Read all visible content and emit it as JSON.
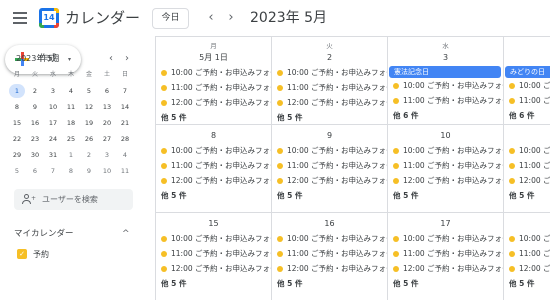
{
  "header": {
    "logo_text": "14",
    "app_title": "カレンダー",
    "today_label": "今日",
    "prev_icon": "‹",
    "next_icon": "›",
    "month_title": "2023年 5月"
  },
  "sidebar": {
    "create_label": "作成",
    "create_caret": "▾",
    "mini_calendar": {
      "title": "2023年 5月",
      "prev_icon": "‹",
      "next_icon": "›",
      "weekdays": [
        "月",
        "火",
        "水",
        "木",
        "金",
        "土",
        "日"
      ],
      "weeks": [
        [
          "1",
          "2",
          "3",
          "4",
          "5",
          "6",
          "7"
        ],
        [
          "8",
          "9",
          "10",
          "11",
          "12",
          "13",
          "14"
        ],
        [
          "15",
          "16",
          "17",
          "18",
          "19",
          "20",
          "21"
        ],
        [
          "22",
          "23",
          "24",
          "25",
          "26",
          "27",
          "28"
        ],
        [
          "29",
          "30",
          "31",
          "1",
          "2",
          "3",
          "4"
        ],
        [
          "5",
          "6",
          "7",
          "8",
          "9",
          "10",
          "11"
        ]
      ],
      "today": "1"
    },
    "search_people": "ユーザーを検索",
    "my_calendars_title": "マイカレンダー",
    "my_calendars_chevron": "^",
    "calendars": [
      {
        "label": "予約",
        "color": "#f6bf26",
        "check": "✓"
      }
    ]
  },
  "grid": {
    "event_color": "#f6bf26",
    "holiday_color": "#4285f4",
    "columns": [
      {
        "dow": "月"
      },
      {
        "dow": "火"
      },
      {
        "dow": "水"
      },
      {
        "dow": "木"
      }
    ],
    "rows": [
      [
        {
          "date": "5月 1日",
          "events": [
            "10:00 ご予約・お申込みフォー",
            "11:00 ご予約・お申込みフォー",
            "12:00 ご予約・お申込みフォー"
          ],
          "more": "他 5 件"
        },
        {
          "date": "2",
          "events": [
            "10:00 ご予約・お申込みフォー",
            "11:00 ご予約・お申込みフォー",
            "12:00 ご予約・お申込みフォー"
          ],
          "more": "他 5 件"
        },
        {
          "date": "3",
          "holiday": "憲法記念日",
          "events": [
            "10:00 ご予約・お申込みフォー",
            "11:00 ご予約・お申込みフォー"
          ],
          "more": "他 6 件"
        },
        {
          "date": "4",
          "holiday": "みどりの日",
          "events": [
            "10:00 ご予約・お申込みフォー",
            "11:00 ご予約・お申込みフォー"
          ],
          "more": "他 6 件"
        }
      ],
      [
        {
          "date": "8",
          "events": [
            "10:00 ご予約・お申込みフォー",
            "11:00 ご予約・お申込みフォー",
            "12:00 ご予約・お申込みフォー"
          ],
          "more": "他 5 件"
        },
        {
          "date": "9",
          "events": [
            "10:00 ご予約・お申込みフォー",
            "11:00 ご予約・お申込みフォー",
            "12:00 ご予約・お申込みフォー"
          ],
          "more": "他 5 件"
        },
        {
          "date": "10",
          "events": [
            "10:00 ご予約・お申込みフォー",
            "11:00 ご予約・お申込みフォー",
            "12:00 ご予約・お申込みフォー"
          ],
          "more": "他 5 件"
        },
        {
          "date": "11",
          "events": [
            "10:00 ご予約・お申込みフォー",
            "11:00 ご予約・お申込みフォー",
            "12:00 ご予約・お申込みフォー"
          ],
          "more": "他 5 件"
        }
      ],
      [
        {
          "date": "15",
          "events": [
            "10:00 ご予約・お申込みフォー",
            "11:00 ご予約・お申込みフォー",
            "12:00 ご予約・お申込みフォー"
          ],
          "more": "他 5 件"
        },
        {
          "date": "16",
          "events": [
            "10:00 ご予約・お申込みフォー",
            "11:00 ご予約・お申込みフォー",
            "12:00 ご予約・お申込みフォー"
          ],
          "more": "他 5 件"
        },
        {
          "date": "17",
          "events": [
            "10:00 ご予約・お申込みフォー",
            "11:00 ご予約・お申込みフォー",
            "12:00 ご予約・お申込みフォー"
          ],
          "more": "他 5 件"
        },
        {
          "date": "18",
          "events": [
            "10:00 ご予約・お申込みフォー",
            "11:00 ご予約・お申込みフォー",
            "12:00 ご予約・お申込みフォー"
          ],
          "more": "他 5 件"
        }
      ]
    ]
  }
}
